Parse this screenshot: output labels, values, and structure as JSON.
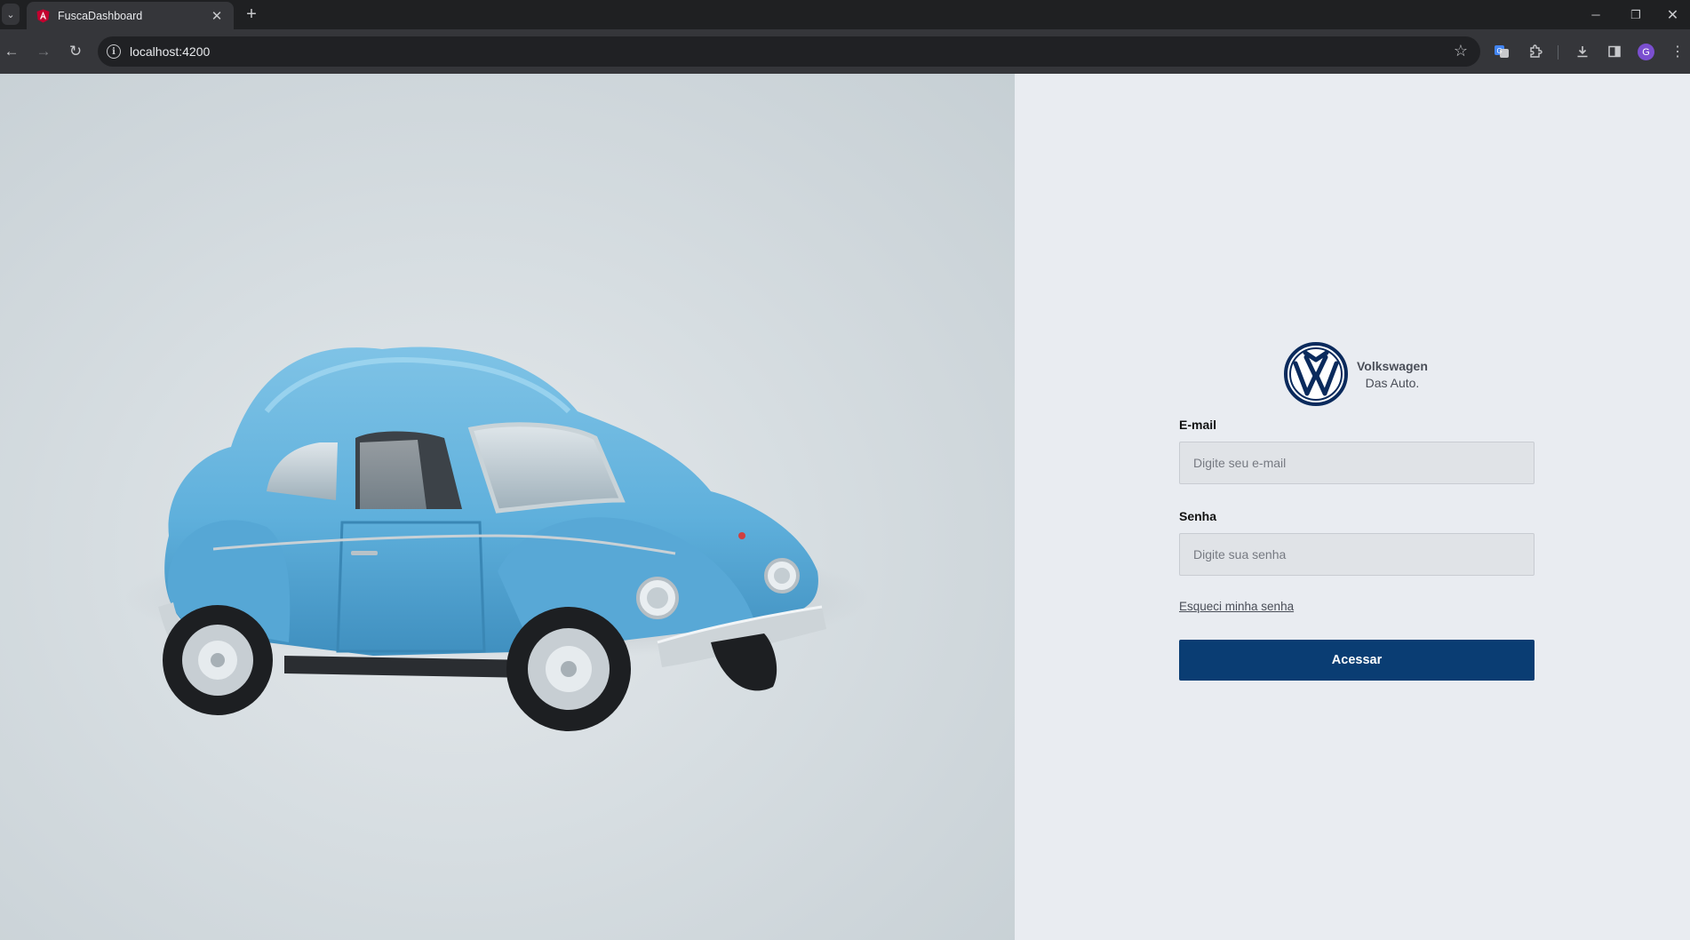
{
  "browser": {
    "tab_title": "FuscaDashboard",
    "url": "localhost:4200",
    "avatar_letter": "G"
  },
  "hero": {
    "image_alt": "Blue Volkswagen Beetle toy car on a light grey background"
  },
  "brand": {
    "name": "Volkswagen",
    "slogan": "Das Auto.",
    "color": "#0a2a5c"
  },
  "login": {
    "email_label": "E-mail",
    "email_placeholder": "Digite seu e-mail",
    "email_value": "",
    "password_label": "Senha",
    "password_placeholder": "Digite sua senha",
    "password_value": "",
    "forgot_link": "Esqueci minha senha",
    "submit_label": "Acessar",
    "submit_color": "#0a3d73"
  },
  "icons": {
    "tab_list": "chevron-down-icon",
    "favicon": "angular-icon",
    "tab_close": "close-icon",
    "new_tab": "plus-icon",
    "back": "arrow-left-icon",
    "forward": "arrow-right-icon",
    "reload": "reload-icon",
    "site_info": "info-icon",
    "bookmark": "star-icon",
    "translate": "translate-icon",
    "extensions": "puzzle-icon",
    "downloads": "download-icon",
    "side_panel": "side-panel-icon",
    "menu": "kebab-menu-icon"
  }
}
